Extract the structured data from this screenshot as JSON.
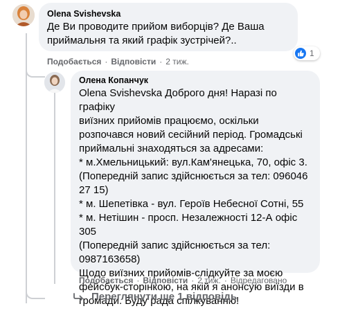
{
  "comment": {
    "author": "Olena Svishevska",
    "text": "Де Ви проводите прийом виборців? Де Ваша\nприймальня та який графік зустрічей?..",
    "reaction_count": "1",
    "actions": {
      "like": "Подобається",
      "reply": "Відповісти",
      "time": "2 тиж."
    }
  },
  "reply": {
    "author": "Олена Копанчук",
    "text": "Olena Svishevska Доброго дня! Наразі по графіку\nвиїзних прийомів працюємо, оскільки\nрозпочався новий сесійний період. Громадські\nприймальні знаходяться за адресами:\n* м.Хмельницький: вул.Кам'янецька, 70, офіс 3.\n(Попередній запис здійснюється за тел: 096046\n27 15)\n* м. Шепетівка - вул. Героїв Небесної Сотні, 55\n* м. Нетішин - просп. Незалежності 12-А офіс 305\n(Попередній запис здійснюється за тел:\n0987163658)\nЩодо виїзних прийомів-слідкуйте за моєю\nфейсбук-сторінкою, на якій я анонсую виїзди в\nгромади. Буду рада спілкуванню!",
    "actions": {
      "like": "Подобається",
      "reply": "Відповісти",
      "time": "2 тиж.",
      "edited": "Відредаговано"
    }
  },
  "more_replies_label": "Переглянути ще 1 відповідь",
  "colors": {
    "bubble": "#f0f2f5",
    "secondary_text": "#65676b",
    "like_blue": "#1877f2",
    "thread_line": "#ced0d4"
  }
}
